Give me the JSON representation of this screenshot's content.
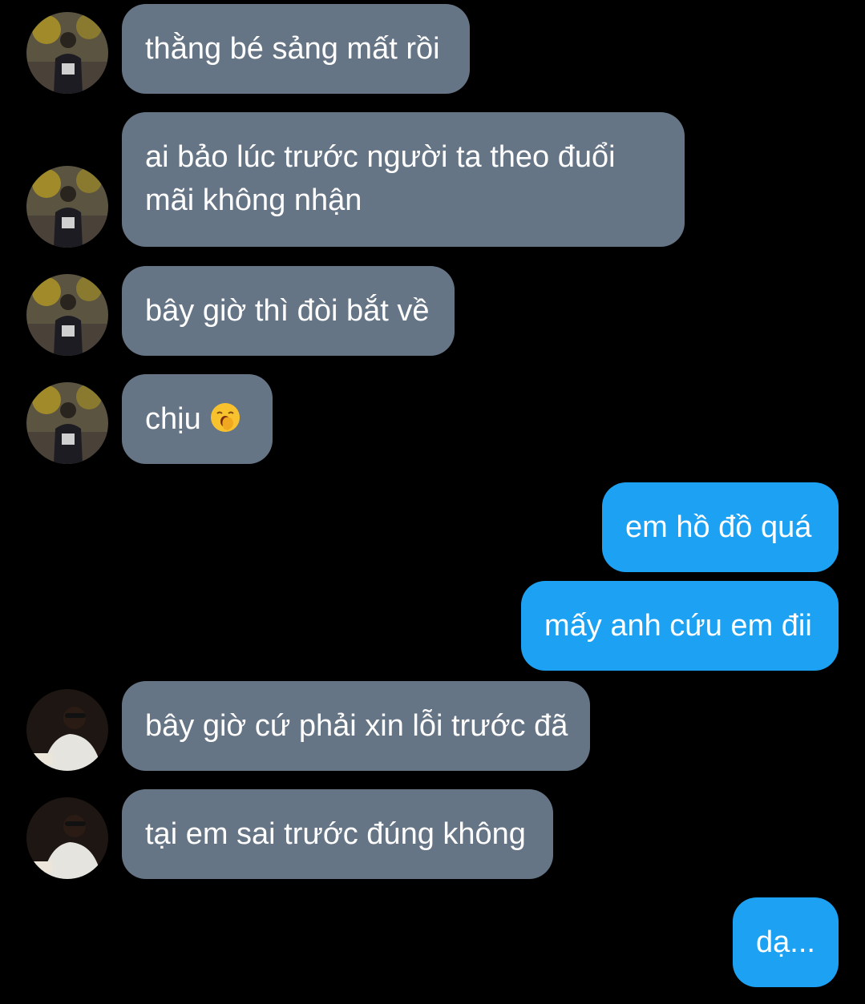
{
  "messages": [
    {
      "side": "in",
      "sender": "a",
      "text": "thằng bé sảng mất rồi"
    },
    {
      "side": "in",
      "sender": "a",
      "text": "ai bảo lúc trước người ta theo đuổi"
    },
    {
      "side": "in",
      "sender": "a",
      "text2": "mãi không nhận"
    },
    {
      "side": "in",
      "sender": "a",
      "text": "bây giờ thì đòi bắt về"
    },
    {
      "side": "in",
      "sender": "a",
      "text": "chịu",
      "emoji": "yawning-face"
    },
    {
      "side": "out",
      "text": "em hồ đồ quá"
    },
    {
      "side": "out",
      "text": "mấy anh cứu em đii"
    },
    {
      "side": "in",
      "sender": "b",
      "text": "bây giờ cứ phải xin lỗi trước đã"
    },
    {
      "side": "in",
      "sender": "b",
      "text": "tại em sai trước đúng không"
    },
    {
      "side": "out",
      "text": "dạ..."
    }
  ],
  "colors": {
    "background": "#000000",
    "incoming_bubble": "#667586",
    "outgoing_bubble": "#1da1f2",
    "text": "#ffffff"
  }
}
